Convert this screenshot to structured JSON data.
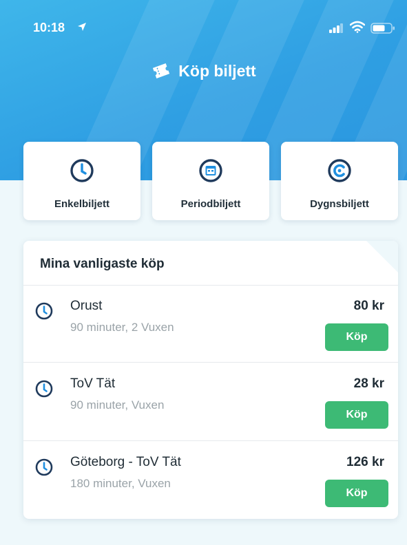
{
  "status_bar": {
    "time": "10:18",
    "icons": [
      "location-arrow-icon",
      "cellular-signal-icon",
      "wifi-icon",
      "battery-icon"
    ]
  },
  "header": {
    "title": "Köp biljett",
    "icon": "ticket-icon"
  },
  "ticket_types": [
    {
      "label": "Enkelbiljett",
      "icon": "clock-icon"
    },
    {
      "label": "Periodbiljett",
      "icon": "calendar-icon"
    },
    {
      "label": "Dygnsbiljett",
      "icon": "day-ticket-icon"
    }
  ],
  "frequent": {
    "title": "Mina vanligaste köp",
    "items": [
      {
        "name": "Orust",
        "details": "90 minuter, 2 Vuxen",
        "price": "80 kr",
        "button": "Köp"
      },
      {
        "name": "ToV Tät",
        "details": "90 minuter, Vuxen",
        "price": "28 kr",
        "button": "Köp"
      },
      {
        "name": "Göteborg - ToV Tät",
        "details": "180 minuter, Vuxen",
        "price": "126 kr",
        "button": "Köp"
      }
    ]
  },
  "colors": {
    "header_blue": "#2f9fe3",
    "buy_green": "#3dba75",
    "icon_navy": "#1f3a5c",
    "background": "#eef8fb"
  }
}
